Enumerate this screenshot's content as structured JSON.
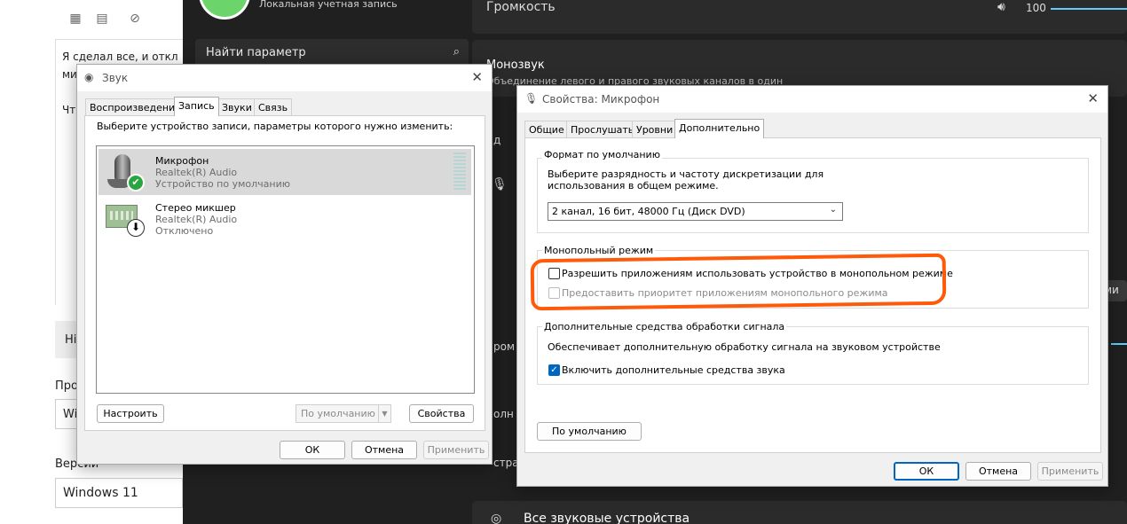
{
  "background_page": {
    "text_line1": "Я сделал все, и откл",
    "text_line2": "ми",
    "text_line3": "Чт",
    "grey_bar_text": "Нi",
    "label_pro": "Про",
    "field_win": "Wi",
    "label_ver": "Версии",
    "field_ver": "Windows 11"
  },
  "settings": {
    "account_label": "Локальная учетная запись",
    "search_placeholder": "Найти параметр",
    "volume_label": "Громкость",
    "volume_value": "100",
    "mono_title": "Монозвук",
    "mono_desc": "Объединение левого и правого звуковых каналов в один",
    "devices_label": "Все звуковые устройства",
    "frag_d": "д",
    "frag_rom": "ром",
    "frag_oln": "олн",
    "frag_stra": "стра",
    "frag_mi": "ми"
  },
  "sound_dialog": {
    "title": "Звук",
    "tabs": [
      "Воспроизведение",
      "Запись",
      "Звуки",
      "Связь"
    ],
    "active_tab": "Запись",
    "hint": "Выберите устройство записи, параметры которого нужно изменить:",
    "devices": [
      {
        "name": "Микрофон",
        "driver": "Realtek(R) Audio",
        "status": "Устройство по умолчанию"
      },
      {
        "name": "Стерео микшер",
        "driver": "Realtek(R) Audio",
        "status": "Отключено"
      }
    ],
    "configure_btn": "Настроить",
    "default_combo": "По умолчанию",
    "properties_btn": "Свойства",
    "ok_btn": "ОК",
    "cancel_btn": "Отмена",
    "apply_btn": "Применить"
  },
  "props_dialog": {
    "title": "Свойства: Микрофон",
    "tabs": [
      "Общие",
      "Прослушать",
      "Уровни",
      "Дополнительно"
    ],
    "active_tab": "Дополнительно",
    "format_group": "Формат по умолчанию",
    "format_desc_1": "Выберите разрядность и частоту дискретизации для",
    "format_desc_2": "использования в общем режиме.",
    "format_value": "2 канал, 16 бит, 48000 Гц (Диск DVD)",
    "exclusive_group": "Монопольный режим",
    "exclusive_allow": "Разрешить приложениям использовать устройство в монопольном режиме",
    "exclusive_allow_checked": false,
    "exclusive_priority": "Предоставить приоритет приложениям монопольного режима",
    "exclusive_priority_checked": false,
    "enh_group": "Дополнительные средства обработки сигнала",
    "enh_desc": "Обеспечивает дополнительную обработку сигнала на звуковом устройстве",
    "enh_enable": "Включить дополнительные средства звука",
    "enh_enable_checked": true,
    "defaults_btn": "По умолчанию",
    "ok_btn": "ОК",
    "cancel_btn": "Отмена",
    "apply_btn": "Применить"
  },
  "annotation": {
    "color": "#ff5a0a"
  }
}
